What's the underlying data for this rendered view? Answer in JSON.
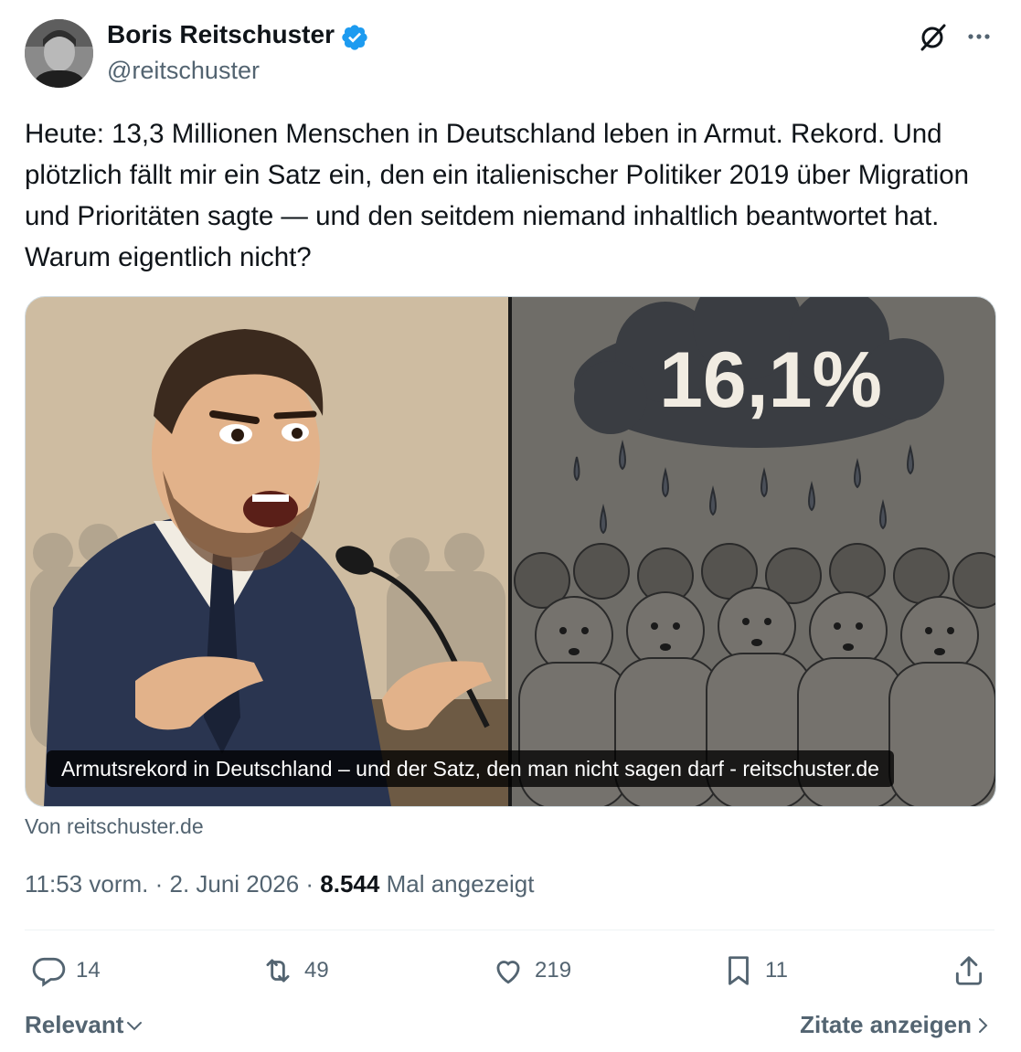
{
  "author": {
    "name": "Boris Reitschuster",
    "handle": "@reitschuster",
    "verified_color": "#1d9bf0"
  },
  "tweet": {
    "text": "Heute: 13,3 Millionen Menschen in Deutschland leben in Armut. Rekord. Und plötzlich fällt mir ein Satz ein, den ein italienischer Politiker 2019 über Migration und Prioritäten sagte — und den seitdem niemand inhaltlich beantwortet hat. Warum eigentlich nicht?"
  },
  "card": {
    "image_text": "16,1%",
    "caption": "Armutsrekord in Deutschland – und der Satz, den man nicht sagen darf - reitschuster.de",
    "source": "Von reitschuster.de"
  },
  "meta": {
    "time": "11:53 vorm.",
    "date": "2. Juni 2026",
    "views": "8.544",
    "views_label": "Mal angezeigt"
  },
  "actions": {
    "replies": "14",
    "reposts": "49",
    "likes": "219",
    "bookmarks": "11"
  },
  "footer": {
    "sort_label": "Relevant",
    "quotes_label": "Zitate anzeigen"
  },
  "icons": [
    "grok-icon",
    "more-icon",
    "reply-icon",
    "repost-icon",
    "like-icon",
    "bookmark-icon",
    "share-icon",
    "chevron-down-icon",
    "chevron-right-icon"
  ]
}
